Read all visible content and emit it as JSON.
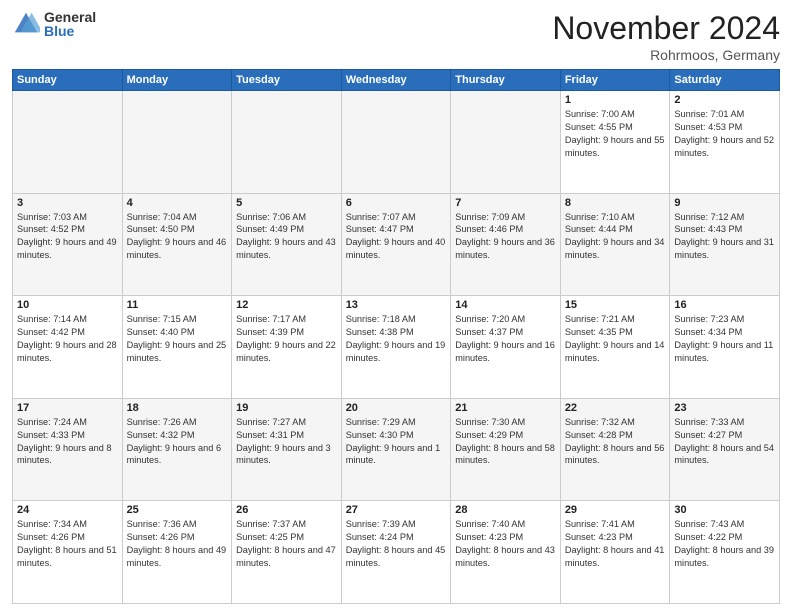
{
  "logo": {
    "general": "General",
    "blue": "Blue"
  },
  "title": "November 2024",
  "location": "Rohrmoos, Germany",
  "weekdays": [
    "Sunday",
    "Monday",
    "Tuesday",
    "Wednesday",
    "Thursday",
    "Friday",
    "Saturday"
  ],
  "rows": [
    [
      {
        "day": "",
        "info": "",
        "empty": true
      },
      {
        "day": "",
        "info": "",
        "empty": true
      },
      {
        "day": "",
        "info": "",
        "empty": true
      },
      {
        "day": "",
        "info": "",
        "empty": true
      },
      {
        "day": "",
        "info": "",
        "empty": true
      },
      {
        "day": "1",
        "info": "Sunrise: 7:00 AM\nSunset: 4:55 PM\nDaylight: 9 hours and 55 minutes."
      },
      {
        "day": "2",
        "info": "Sunrise: 7:01 AM\nSunset: 4:53 PM\nDaylight: 9 hours and 52 minutes."
      }
    ],
    [
      {
        "day": "3",
        "info": "Sunrise: 7:03 AM\nSunset: 4:52 PM\nDaylight: 9 hours and 49 minutes."
      },
      {
        "day": "4",
        "info": "Sunrise: 7:04 AM\nSunset: 4:50 PM\nDaylight: 9 hours and 46 minutes."
      },
      {
        "day": "5",
        "info": "Sunrise: 7:06 AM\nSunset: 4:49 PM\nDaylight: 9 hours and 43 minutes."
      },
      {
        "day": "6",
        "info": "Sunrise: 7:07 AM\nSunset: 4:47 PM\nDaylight: 9 hours and 40 minutes."
      },
      {
        "day": "7",
        "info": "Sunrise: 7:09 AM\nSunset: 4:46 PM\nDaylight: 9 hours and 36 minutes."
      },
      {
        "day": "8",
        "info": "Sunrise: 7:10 AM\nSunset: 4:44 PM\nDaylight: 9 hours and 34 minutes."
      },
      {
        "day": "9",
        "info": "Sunrise: 7:12 AM\nSunset: 4:43 PM\nDaylight: 9 hours and 31 minutes."
      }
    ],
    [
      {
        "day": "10",
        "info": "Sunrise: 7:14 AM\nSunset: 4:42 PM\nDaylight: 9 hours and 28 minutes."
      },
      {
        "day": "11",
        "info": "Sunrise: 7:15 AM\nSunset: 4:40 PM\nDaylight: 9 hours and 25 minutes."
      },
      {
        "day": "12",
        "info": "Sunrise: 7:17 AM\nSunset: 4:39 PM\nDaylight: 9 hours and 22 minutes."
      },
      {
        "day": "13",
        "info": "Sunrise: 7:18 AM\nSunset: 4:38 PM\nDaylight: 9 hours and 19 minutes."
      },
      {
        "day": "14",
        "info": "Sunrise: 7:20 AM\nSunset: 4:37 PM\nDaylight: 9 hours and 16 minutes."
      },
      {
        "day": "15",
        "info": "Sunrise: 7:21 AM\nSunset: 4:35 PM\nDaylight: 9 hours and 14 minutes."
      },
      {
        "day": "16",
        "info": "Sunrise: 7:23 AM\nSunset: 4:34 PM\nDaylight: 9 hours and 11 minutes."
      }
    ],
    [
      {
        "day": "17",
        "info": "Sunrise: 7:24 AM\nSunset: 4:33 PM\nDaylight: 9 hours and 8 minutes."
      },
      {
        "day": "18",
        "info": "Sunrise: 7:26 AM\nSunset: 4:32 PM\nDaylight: 9 hours and 6 minutes."
      },
      {
        "day": "19",
        "info": "Sunrise: 7:27 AM\nSunset: 4:31 PM\nDaylight: 9 hours and 3 minutes."
      },
      {
        "day": "20",
        "info": "Sunrise: 7:29 AM\nSunset: 4:30 PM\nDaylight: 9 hours and 1 minute."
      },
      {
        "day": "21",
        "info": "Sunrise: 7:30 AM\nSunset: 4:29 PM\nDaylight: 8 hours and 58 minutes."
      },
      {
        "day": "22",
        "info": "Sunrise: 7:32 AM\nSunset: 4:28 PM\nDaylight: 8 hours and 56 minutes."
      },
      {
        "day": "23",
        "info": "Sunrise: 7:33 AM\nSunset: 4:27 PM\nDaylight: 8 hours and 54 minutes."
      }
    ],
    [
      {
        "day": "24",
        "info": "Sunrise: 7:34 AM\nSunset: 4:26 PM\nDaylight: 8 hours and 51 minutes."
      },
      {
        "day": "25",
        "info": "Sunrise: 7:36 AM\nSunset: 4:26 PM\nDaylight: 8 hours and 49 minutes."
      },
      {
        "day": "26",
        "info": "Sunrise: 7:37 AM\nSunset: 4:25 PM\nDaylight: 8 hours and 47 minutes."
      },
      {
        "day": "27",
        "info": "Sunrise: 7:39 AM\nSunset: 4:24 PM\nDaylight: 8 hours and 45 minutes."
      },
      {
        "day": "28",
        "info": "Sunrise: 7:40 AM\nSunset: 4:23 PM\nDaylight: 8 hours and 43 minutes."
      },
      {
        "day": "29",
        "info": "Sunrise: 7:41 AM\nSunset: 4:23 PM\nDaylight: 8 hours and 41 minutes."
      },
      {
        "day": "30",
        "info": "Sunrise: 7:43 AM\nSunset: 4:22 PM\nDaylight: 8 hours and 39 minutes."
      }
    ]
  ]
}
